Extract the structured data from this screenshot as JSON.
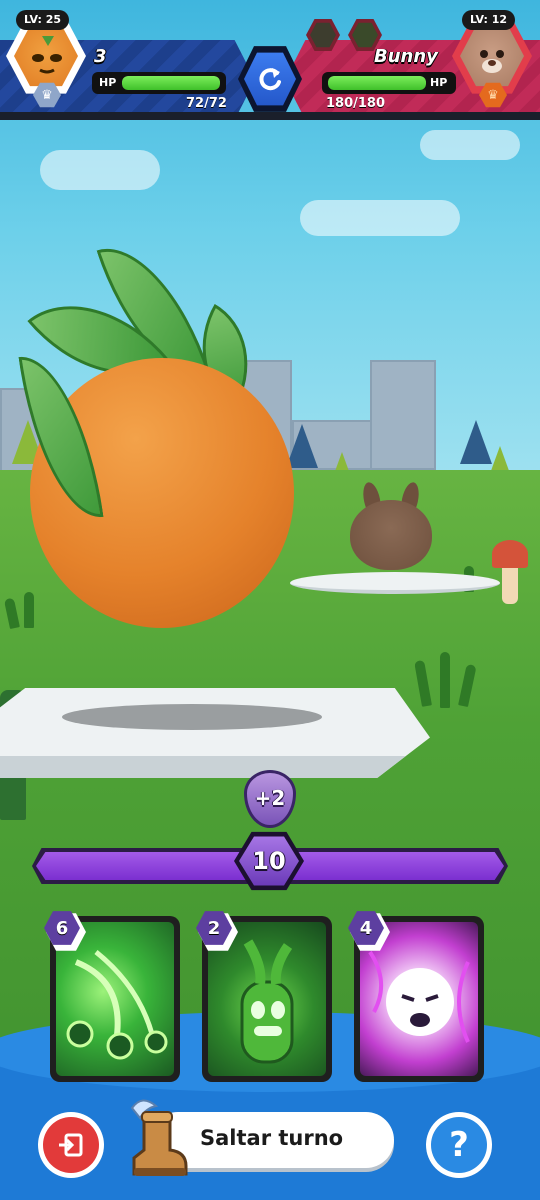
{
  "player": {
    "level_label": "LV: 25",
    "name": "3",
    "hp_label": "HP",
    "hp_text": "72/72",
    "hp_current": 72,
    "hp_max": 72
  },
  "opponent": {
    "level_label": "LV: 12",
    "name": "Bunny",
    "hp_label": "HP",
    "hp_text": "180/180",
    "hp_current": 180,
    "hp_max": 180
  },
  "energy": {
    "value": "10",
    "bonus": "+2",
    "fill_fraction": 1.0
  },
  "cards": [
    {
      "cost": "6",
      "art": "green-spiral-seeds",
      "icon": "seed-burst-icon"
    },
    {
      "cost": "2",
      "art": "green-sprout-monster",
      "icon": "sprout-icon"
    },
    {
      "cost": "4",
      "art": "purple-storm-spirit",
      "icon": "storm-spirit-icon"
    }
  ],
  "controls": {
    "skip_turn_label": "Saltar turno",
    "help_symbol": "?"
  },
  "colors": {
    "player_team": "#1d3f8c",
    "opponent_team": "#b2244f",
    "hp_bar": "#3fc02a",
    "energy": "#7b2fd0"
  }
}
